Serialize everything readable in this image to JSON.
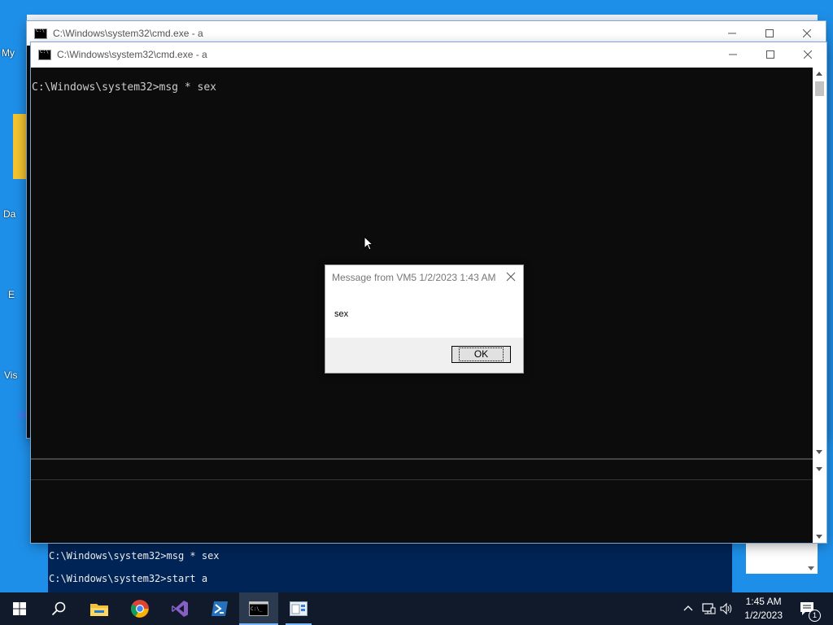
{
  "desktop": {
    "icon_labels": [
      "My",
      "Da",
      "E",
      "Vis"
    ]
  },
  "back_window": {
    "title": "C:\\Windows\\system32\\cmd.exe - a"
  },
  "front_window": {
    "title": "C:\\Windows\\system32\\cmd.exe - a",
    "console_line": "C:\\Windows\\system32>msg * sex"
  },
  "powershell": {
    "lines": [
      "C:\\Windows\\system32>msg * sex",
      "C:\\Windows\\system32>start a"
    ]
  },
  "dialog": {
    "title": "Message from VM5 1/2/2023 1:43 AM",
    "message": "sex",
    "ok_label": "OK"
  },
  "taskbar": {
    "time": "1:45 AM",
    "date": "1/2/2023",
    "notification_count": "1",
    "items": [
      "start-icon",
      "search-icon",
      "file-explorer-icon",
      "chrome-icon",
      "visual-studio-icon",
      "powershell-icon",
      "cmd-icon",
      "app-icon"
    ]
  },
  "colors": {
    "desktop": "#1e8fe8",
    "console_bg": "#0c0c0c",
    "powershell_bg": "#012456",
    "taskbar": "#101a2a"
  }
}
